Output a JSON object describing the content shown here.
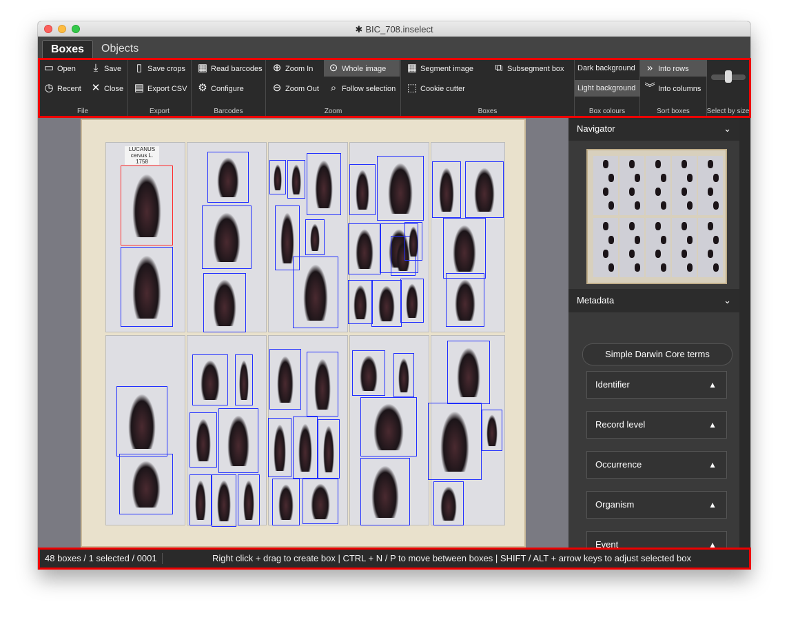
{
  "window": {
    "title": "BIC_708.inselect"
  },
  "tabs": [
    {
      "label": "Boxes"
    },
    {
      "label": "Objects"
    }
  ],
  "ribbon": {
    "file": {
      "label": "File",
      "open": "Open",
      "save": "Save",
      "recent": "Recent",
      "close": "Close"
    },
    "export": {
      "label": "Export",
      "save_crops": "Save crops",
      "export_csv": "Export CSV"
    },
    "barcodes": {
      "label": "Barcodes",
      "read_barcodes": "Read barcodes",
      "configure": "Configure"
    },
    "zoom": {
      "label": "Zoom",
      "zoom_in": "Zoom In",
      "zoom_out": "Zoom Out",
      "whole_image": "Whole image",
      "follow_selection": "Follow selection"
    },
    "boxes": {
      "label": "Boxes",
      "segment_image": "Segment image",
      "subsegment_box": "Subsegment box",
      "cookie_cutter": "Cookie cutter"
    },
    "box_colours": {
      "label": "Box colours",
      "dark_background": "Dark background",
      "light_background": "Light background",
      "selected": "Light background"
    },
    "sort_boxes": {
      "label": "Sort boxes",
      "into_rows": "Into rows",
      "into_columns": "Into columns",
      "selected": "Into rows"
    },
    "select_by_size": {
      "label": "Select by size"
    }
  },
  "image": {
    "tray_label": "LUCANUS cervus L. 1758",
    "boxes_total": 48,
    "selected_index": 1
  },
  "side_panel": {
    "navigator": {
      "label": "Navigator"
    },
    "metadata": {
      "label": "Metadata"
    },
    "template_button": "Simple Darwin Core terms",
    "sections": [
      {
        "label": "Identifier"
      },
      {
        "label": "Record level"
      },
      {
        "label": "Occurrence"
      },
      {
        "label": "Organism"
      },
      {
        "label": "Event"
      }
    ]
  },
  "status": {
    "count": "48 boxes / 1 selected / 0001",
    "hint": "Right click + drag to create box  |  CTRL + N / P to move between boxes  |  SHIFT / ALT + arrow keys to adjust selected box"
  },
  "colors": {
    "box": "#2230ff",
    "selected_box": "#ff2a2a",
    "highlight": "#ee0000"
  },
  "icons": [
    "folder-open-icon",
    "save-download-icon",
    "recent-clock-icon",
    "close-x-icon",
    "save-crops-icon",
    "export-csv-icon",
    "barcode-icon",
    "gear-icon",
    "zoom-in-icon",
    "zoom-out-icon",
    "whole-image-icon",
    "follow-selection-icon",
    "segment-image-icon",
    "subsegment-icon",
    "cookie-cutter-icon",
    "into-rows-icon",
    "into-columns-icon",
    "chevron-down-icon",
    "chevron-up-icon"
  ]
}
